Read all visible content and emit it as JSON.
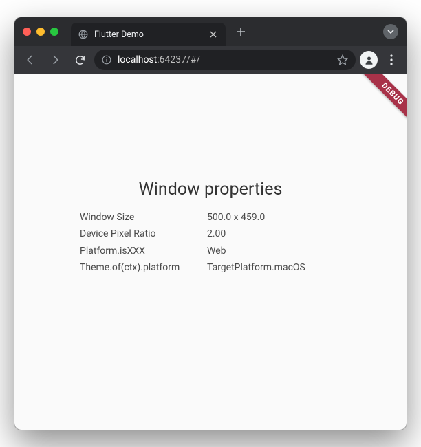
{
  "colors": {
    "window_bg": "#2b2c2f",
    "toolbar_bg": "#35363a",
    "omnibox_bg": "#202124",
    "content_bg": "#fafafa",
    "debug_banner": "#a83249"
  },
  "tab": {
    "title": "Flutter Demo"
  },
  "address_bar": {
    "host": "localhost",
    "port_and_path": ":64237/#/"
  },
  "debug_banner": {
    "text": "DEBUG"
  },
  "page": {
    "heading": "Window properties",
    "properties": [
      {
        "label": "Window Size",
        "value": "500.0 x 459.0"
      },
      {
        "label": "Device Pixel Ratio",
        "value": "2.00"
      },
      {
        "label": "Platform.isXXX",
        "value": "Web"
      },
      {
        "label": "Theme.of(ctx).platform",
        "value": "TargetPlatform.macOS"
      }
    ]
  }
}
